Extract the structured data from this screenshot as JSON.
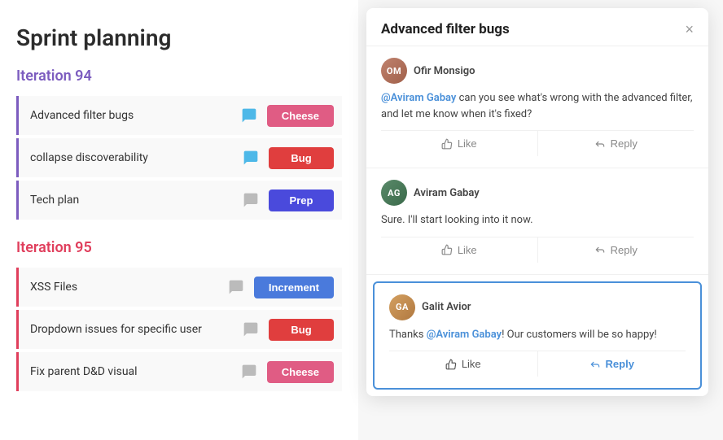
{
  "page": {
    "title": "Sprint planning"
  },
  "iterations": [
    {
      "id": "iter-94",
      "label": "Iteration 94",
      "color": "purple",
      "tasks": [
        {
          "id": "t1",
          "name": "Advanced filter bugs",
          "icon": "chat-active",
          "tag": "Cheese",
          "tagClass": "tag-cheese"
        },
        {
          "id": "t2",
          "name": "collapse discoverability",
          "icon": "chat-active",
          "tag": "Bug",
          "tagClass": "tag-bug"
        },
        {
          "id": "t3",
          "name": "Tech plan",
          "icon": "chat-gray",
          "tag": "Prep",
          "tagClass": "tag-prep"
        }
      ]
    },
    {
      "id": "iter-95",
      "label": "Iteration 95",
      "color": "red",
      "tasks": [
        {
          "id": "t4",
          "name": "XSS Files",
          "icon": "chat-gray",
          "tag": "Increment",
          "tagClass": "tag-increment"
        },
        {
          "id": "t5",
          "name": "Dropdown issues for specific user",
          "icon": "chat-gray",
          "tag": "Bug",
          "tagClass": "tag-bug"
        },
        {
          "id": "t6",
          "name": "Fix parent D&D visual",
          "icon": "chat-gray",
          "tag": "Cheese",
          "tagClass": "tag-cheese"
        }
      ]
    }
  ],
  "modal": {
    "title": "Advanced filter bugs",
    "close_label": "×",
    "comments": [
      {
        "id": "c1",
        "user": "Ofir Monsigo",
        "avatar_label": "OM",
        "avatar_class": "avatar-ofir",
        "text_parts": [
          {
            "type": "mention",
            "text": "@Aviram Gabay"
          },
          {
            "type": "text",
            "text": " can you see what's wrong with the advanced filter, and let me know when it's fixed?"
          }
        ],
        "like_label": "Like",
        "reply_label": "Reply",
        "active": false
      },
      {
        "id": "c2",
        "user": "Aviram Gabay",
        "avatar_label": "AG",
        "avatar_class": "avatar-aviram",
        "text_parts": [
          {
            "type": "text",
            "text": "Sure. I'll start looking into it now."
          }
        ],
        "like_label": "Like",
        "reply_label": "Reply",
        "active": false
      },
      {
        "id": "c3",
        "user": "Galit Avior",
        "avatar_label": "GA",
        "avatar_class": "avatar-galit",
        "text_parts": [
          {
            "type": "text",
            "text": "Thanks "
          },
          {
            "type": "mention",
            "text": "@Aviram Gabay"
          },
          {
            "type": "text",
            "text": "! Our customers will be so happy!"
          }
        ],
        "like_label": "Like",
        "reply_label": "Reply",
        "active": true
      }
    ]
  }
}
